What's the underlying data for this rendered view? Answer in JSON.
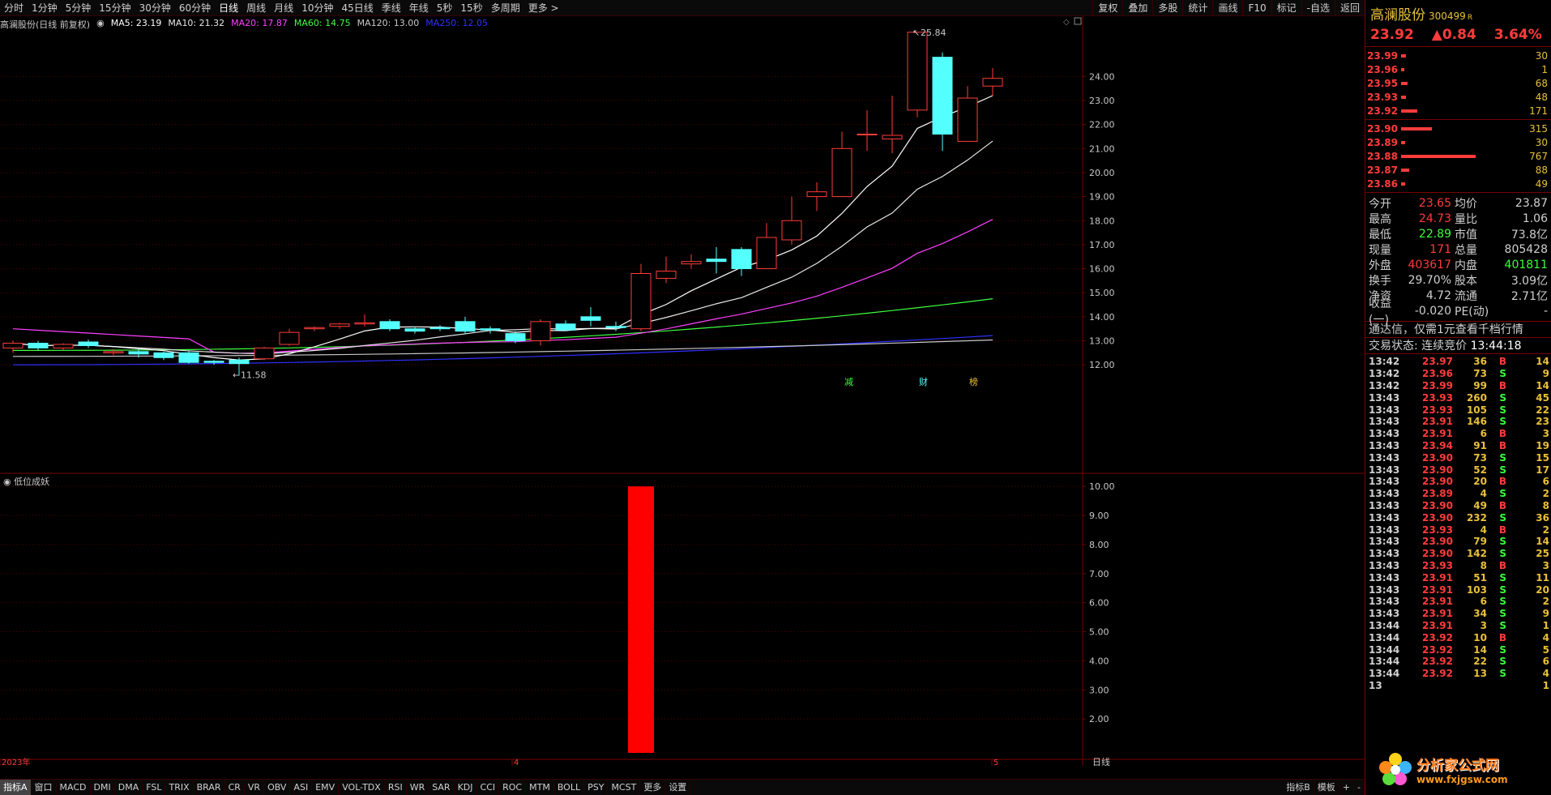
{
  "toolbar": {
    "periods": [
      "分时",
      "1分钟",
      "5分钟",
      "15分钟",
      "30分钟",
      "60分钟",
      "日线",
      "周线",
      "月线",
      "10分钟",
      "45日线",
      "季线",
      "年线",
      "5秒",
      "15秒",
      "多周期",
      "更多 >"
    ],
    "active_period": "日线",
    "tools": [
      "复权",
      "叠加",
      "多股",
      "统计",
      "画线",
      "F10",
      "标记",
      "-自选",
      "返回"
    ]
  },
  "ma_legend": {
    "title": "高澜股份(日线 前复权)",
    "ma5": "MA5: 23.19",
    "ma10": "MA10: 21.32",
    "ma20": "MA20: 17.87",
    "ma60": "MA60: 14.75",
    "ma120": "MA120: 13.00",
    "ma250": "MA250: 12.05"
  },
  "colors": {
    "up": "#ff3c3c",
    "down": "#54ffff",
    "grid": "#5a0000",
    "ma5": "#ffffff",
    "ma10": "#e8e8e8",
    "ma20": "#ff40ff",
    "ma60": "#40ff40",
    "ma120": "#c8c8c8",
    "ma250": "#3030ff"
  },
  "main_chart": {
    "y_ticks": [
      "24.00",
      "23.00",
      "22.00",
      "21.00",
      "20.00",
      "19.00",
      "18.00",
      "17.00",
      "16.00",
      "15.00",
      "14.00",
      "13.00",
      "12.00"
    ],
    "high_label": "25.84",
    "low_label": "11.58",
    "events": [
      "减",
      "财",
      "榜"
    ]
  },
  "sub_chart": {
    "title": "低位成妖",
    "y_ticks": [
      "10.00",
      "9.00",
      "8.00",
      "7.00",
      "6.00",
      "5.00",
      "4.00",
      "3.00",
      "2.00"
    ]
  },
  "x_axis": {
    "labels": [
      "2023年",
      "4",
      "5"
    ],
    "period_label": "日线"
  },
  "chart_data": {
    "type": "candlestick",
    "y_range": [
      11.5,
      25.9
    ],
    "candles": [
      {
        "o": 12.7,
        "h": 13.0,
        "l": 12.5,
        "c": 12.9
      },
      {
        "o": 12.9,
        "h": 13.0,
        "l": 12.6,
        "c": 12.7
      },
      {
        "o": 12.7,
        "h": 12.9,
        "l": 12.6,
        "c": 12.85
      },
      {
        "o": 12.95,
        "h": 13.05,
        "l": 12.7,
        "c": 12.8
      },
      {
        "o": 12.5,
        "h": 12.65,
        "l": 12.4,
        "c": 12.55
      },
      {
        "o": 12.55,
        "h": 12.65,
        "l": 12.3,
        "c": 12.45
      },
      {
        "o": 12.5,
        "h": 12.55,
        "l": 12.2,
        "c": 12.3
      },
      {
        "o": 12.5,
        "h": 12.6,
        "l": 12.05,
        "c": 12.1
      },
      {
        "o": 12.15,
        "h": 12.2,
        "l": 12.0,
        "c": 12.1
      },
      {
        "o": 12.2,
        "h": 12.3,
        "l": 11.58,
        "c": 12.05
      },
      {
        "o": 12.25,
        "h": 12.75,
        "l": 12.2,
        "c": 12.7
      },
      {
        "o": 12.85,
        "h": 13.5,
        "l": 12.8,
        "c": 13.35
      },
      {
        "o": 13.5,
        "h": 13.6,
        "l": 13.4,
        "c": 13.55
      },
      {
        "o": 13.6,
        "h": 13.75,
        "l": 13.5,
        "c": 13.7
      },
      {
        "o": 13.7,
        "h": 14.1,
        "l": 13.6,
        "c": 13.75
      },
      {
        "o": 13.8,
        "h": 13.9,
        "l": 13.4,
        "c": 13.5
      },
      {
        "o": 13.5,
        "h": 13.6,
        "l": 13.3,
        "c": 13.4
      },
      {
        "o": 13.55,
        "h": 13.65,
        "l": 13.4,
        "c": 13.5
      },
      {
        "o": 13.8,
        "h": 14.0,
        "l": 13.3,
        "c": 13.4
      },
      {
        "o": 13.5,
        "h": 13.6,
        "l": 13.3,
        "c": 13.45
      },
      {
        "o": 13.3,
        "h": 13.4,
        "l": 12.9,
        "c": 13.0
      },
      {
        "o": 13.0,
        "h": 13.9,
        "l": 12.8,
        "c": 13.8
      },
      {
        "o": 13.7,
        "h": 13.85,
        "l": 13.4,
        "c": 13.45
      },
      {
        "o": 14.0,
        "h": 14.4,
        "l": 13.6,
        "c": 13.85
      },
      {
        "o": 13.6,
        "h": 13.8,
        "l": 13.4,
        "c": 13.55
      },
      {
        "o": 13.5,
        "h": 16.2,
        "l": 13.4,
        "c": 15.8
      },
      {
        "o": 15.6,
        "h": 16.5,
        "l": 15.4,
        "c": 15.9
      },
      {
        "o": 16.2,
        "h": 16.6,
        "l": 16.0,
        "c": 16.3
      },
      {
        "o": 16.4,
        "h": 16.9,
        "l": 15.8,
        "c": 16.3
      },
      {
        "o": 16.8,
        "h": 16.9,
        "l": 15.7,
        "c": 16.0
      },
      {
        "o": 16.0,
        "h": 17.9,
        "l": 16.0,
        "c": 17.3
      },
      {
        "o": 17.2,
        "h": 19.0,
        "l": 17.0,
        "c": 18.0
      },
      {
        "o": 19.0,
        "h": 19.6,
        "l": 18.4,
        "c": 19.2
      },
      {
        "o": 19.0,
        "h": 21.7,
        "l": 19.0,
        "c": 21.0
      },
      {
        "o": 21.6,
        "h": 22.6,
        "l": 20.9,
        "c": 21.6
      },
      {
        "o": 21.4,
        "h": 23.2,
        "l": 20.8,
        "c": 21.55
      },
      {
        "o": 22.6,
        "h": 25.84,
        "l": 22.3,
        "c": 25.84
      },
      {
        "o": 24.8,
        "h": 25.0,
        "l": 20.9,
        "c": 21.6
      },
      {
        "o": 21.3,
        "h": 23.6,
        "l": 21.3,
        "c": 23.1
      },
      {
        "o": 23.6,
        "h": 24.35,
        "l": 23.2,
        "c": 23.92
      }
    ],
    "signal_bar": {
      "index": 25,
      "value": 10.0,
      "y_range": [
        1.0,
        10.2
      ]
    }
  },
  "bottom_tabs": {
    "items": [
      "指标A",
      "窗口",
      "MACD",
      "DMI",
      "DMA",
      "FSL",
      "TRIX",
      "BRAR",
      "CR",
      "VR",
      "OBV",
      "ASI",
      "EMV",
      "VOL-TDX",
      "RSI",
      "WR",
      "SAR",
      "KDJ",
      "CCI",
      "ROC",
      "MTM",
      "BOLL",
      "PSY",
      "MCST",
      "更多",
      "设置"
    ],
    "active": "指标A",
    "right": [
      "指标B",
      "模板",
      "+",
      "-"
    ]
  },
  "quote": {
    "name": "高澜股份",
    "code": "300499",
    "mark": "R",
    "price": "23.92",
    "change": "▲0.84",
    "pct": "3.64%",
    "asks": [
      {
        "lvl": "",
        "price": "23.99",
        "bar": 6,
        "vol": "30"
      },
      {
        "lvl": "",
        "price": "23.96",
        "bar": 4,
        "vol": "1"
      },
      {
        "lvl": "",
        "price": "23.95",
        "bar": 8,
        "vol": "68"
      },
      {
        "lvl": "",
        "price": "23.93",
        "bar": 6,
        "vol": "48"
      },
      {
        "lvl": "",
        "price": "23.92",
        "bar": 20,
        "vol": "171"
      }
    ],
    "bids": [
      {
        "lvl": "",
        "price": "23.90",
        "bar": 38,
        "vol": "315"
      },
      {
        "lvl": "",
        "price": "23.89",
        "bar": 5,
        "vol": "30"
      },
      {
        "lvl": "",
        "price": "23.88",
        "bar": 92,
        "vol": "767"
      },
      {
        "lvl": "",
        "price": "23.87",
        "bar": 10,
        "vol": "88"
      },
      {
        "lvl": "",
        "price": "23.86",
        "bar": 5,
        "vol": "49"
      }
    ],
    "stats": [
      {
        "l1": "今开",
        "v1": "23.65",
        "c1": "",
        "l2": "均价",
        "v2": "23.87",
        "c2": ""
      },
      {
        "l1": "最高",
        "v1": "24.73",
        "c1": "",
        "l2": "量比",
        "v2": "1.06",
        "c2": ""
      },
      {
        "l1": "最低",
        "v1": "22.89",
        "c1": "g",
        "l2": "市值",
        "v2": "73.8亿",
        "c2": ""
      },
      {
        "l1": "现量",
        "v1": "171",
        "c1": "",
        "l2": "总量",
        "v2": "805428",
        "c2": ""
      },
      {
        "l1": "外盘",
        "v1": "403617",
        "c1": "",
        "l2": "内盘",
        "v2": "401811",
        "c2": "g"
      },
      {
        "l1": "换手",
        "v1": "29.70%",
        "c1": "w",
        "l2": "股本",
        "v2": "3.09亿",
        "c2": ""
      },
      {
        "l1": "净资",
        "v1": "4.72",
        "c1": "w",
        "l2": "流通",
        "v2": "2.71亿",
        "c2": ""
      },
      {
        "l1": "收益(一)",
        "v1": "-0.020",
        "c1": "w",
        "l2": "PE(动)",
        "v2": "-",
        "c2": ""
      }
    ],
    "info": "通达信，仅需1元查看千档行情",
    "status_label": "交易状态: 连续竞价",
    "status_time": "13:44:18",
    "ticks": [
      {
        "t": "13:42",
        "p": "23.97",
        "v": "36",
        "s": "B",
        "n": "14"
      },
      {
        "t": "13:42",
        "p": "23.96",
        "v": "73",
        "s": "S",
        "n": "9"
      },
      {
        "t": "13:42",
        "p": "23.99",
        "v": "99",
        "s": "B",
        "n": "14"
      },
      {
        "t": "13:43",
        "p": "23.93",
        "v": "260",
        "s": "S",
        "n": "45"
      },
      {
        "t": "13:43",
        "p": "23.93",
        "v": "105",
        "s": "S",
        "n": "22"
      },
      {
        "t": "13:43",
        "p": "23.91",
        "v": "146",
        "s": "S",
        "n": "23"
      },
      {
        "t": "13:43",
        "p": "23.91",
        "v": "6",
        "s": "B",
        "n": "3"
      },
      {
        "t": "13:43",
        "p": "23.94",
        "v": "91",
        "s": "B",
        "n": "19"
      },
      {
        "t": "13:43",
        "p": "23.90",
        "v": "73",
        "s": "S",
        "n": "15"
      },
      {
        "t": "13:43",
        "p": "23.90",
        "v": "52",
        "s": "S",
        "n": "17"
      },
      {
        "t": "13:43",
        "p": "23.90",
        "v": "20",
        "s": "B",
        "n": "6"
      },
      {
        "t": "13:43",
        "p": "23.89",
        "v": "4",
        "s": "S",
        "n": "2"
      },
      {
        "t": "13:43",
        "p": "23.90",
        "v": "49",
        "s": "B",
        "n": "8"
      },
      {
        "t": "13:43",
        "p": "23.90",
        "v": "232",
        "s": "S",
        "n": "36"
      },
      {
        "t": "13:43",
        "p": "23.93",
        "v": "4",
        "s": "B",
        "n": "2"
      },
      {
        "t": "13:43",
        "p": "23.90",
        "v": "79",
        "s": "S",
        "n": "14"
      },
      {
        "t": "13:43",
        "p": "23.90",
        "v": "142",
        "s": "S",
        "n": "25"
      },
      {
        "t": "13:43",
        "p": "23.93",
        "v": "8",
        "s": "B",
        "n": "3"
      },
      {
        "t": "13:43",
        "p": "23.91",
        "v": "51",
        "s": "S",
        "n": "11"
      },
      {
        "t": "13:43",
        "p": "23.91",
        "v": "103",
        "s": "S",
        "n": "20"
      },
      {
        "t": "13:43",
        "p": "23.91",
        "v": "6",
        "s": "S",
        "n": "2"
      },
      {
        "t": "13:43",
        "p": "23.91",
        "v": "34",
        "s": "S",
        "n": "9"
      },
      {
        "t": "13:44",
        "p": "23.91",
        "v": "3",
        "s": "S",
        "n": "1"
      },
      {
        "t": "13:44",
        "p": "23.92",
        "v": "10",
        "s": "B",
        "n": "4"
      },
      {
        "t": "13:44",
        "p": "23.92",
        "v": "14",
        "s": "S",
        "n": "5"
      },
      {
        "t": "13:44",
        "p": "23.92",
        "v": "22",
        "s": "S",
        "n": "6"
      },
      {
        "t": "13:44",
        "p": "23.92",
        "v": "13",
        "s": "S",
        "n": "4"
      },
      {
        "t": "13",
        "p": "",
        "v": "",
        "s": "",
        "n": "1"
      }
    ]
  },
  "watermark": {
    "cn": "分析家公式网",
    "url": "www.fxjgsw.com"
  }
}
